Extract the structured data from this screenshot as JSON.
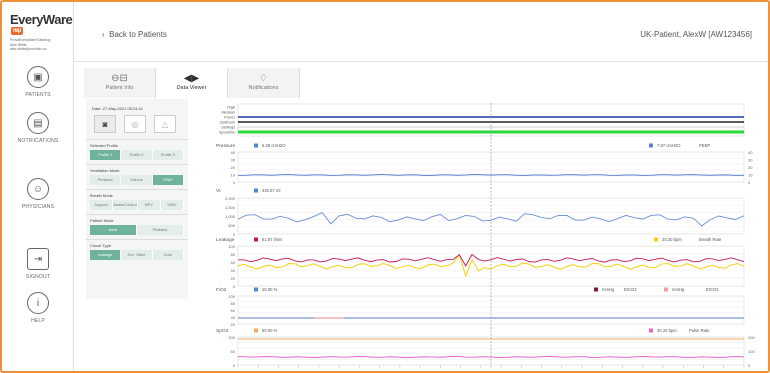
{
  "app": {
    "logo": "EveryWare",
    "logo_badge": "rep",
    "logo_sub": "by Breas"
  },
  "user": {
    "lines": [
      "ProvaEveryWareTrainAng",
      "Alex White",
      "alex.white@ourclinic.co"
    ]
  },
  "nav": [
    {
      "id": "patients",
      "label": "PATIENTS",
      "icon": "patients-icon"
    },
    {
      "id": "notifications",
      "label": "NOTIFICATIONS",
      "icon": "bell-icon"
    },
    {
      "id": "physicians",
      "label": "PHYSICIANS",
      "icon": "physician-icon"
    },
    {
      "id": "signout",
      "label": "SIGNOUT",
      "icon": "signout-icon"
    },
    {
      "id": "help",
      "label": "HELP",
      "icon": "help-icon"
    }
  ],
  "header": {
    "back": "Back to Patients",
    "patient": "UK-Patient, AlexW [AW123456]"
  },
  "tabs": [
    {
      "label": "Patient Info",
      "icon": "patient-info-icon"
    },
    {
      "label": "Data Viewer",
      "icon": "data-viewer-icon",
      "active": true
    },
    {
      "label": "Notifications",
      "icon": "bell-icon"
    }
  ],
  "panel": {
    "date": "Date: 27-May-2021 05:24:41",
    "groups": [
      {
        "label": "Selected Profile",
        "options": [
          "Profile 1",
          "Profile 2",
          "Profile 3"
        ],
        "selected": 0
      },
      {
        "label": "Ventilation Mode",
        "options": [
          "Pressure",
          "Volume",
          "CPAP"
        ],
        "selected": 2
      },
      {
        "label": "Breath Mode",
        "options": [
          "Support",
          "Assist/Control",
          "MPV",
          "SIMV"
        ],
        "selected": -1
      },
      {
        "label": "Patient Mode",
        "options": [
          "Adult",
          "Pediatric"
        ],
        "selected": 0
      },
      {
        "label": "Circuit Type",
        "options": [
          "Leakage",
          "Exh. Valve",
          "Dual"
        ],
        "selected": 0
      }
    ]
  },
  "charts": {
    "status_rows": [
      "High",
      "Medium",
      "Power",
      "Optimum",
      "Settings",
      "Spontime"
    ],
    "pressure": {
      "title": "Pressure",
      "legend_left": "6.28 cmH2O",
      "legend_right": "7.87 cmH2O",
      "legend_right_name": "PEEP",
      "yticks": [
        "40",
        "30",
        "20",
        "10",
        "0"
      ]
    },
    "vt": {
      "title": "Vt",
      "legend_left": "440.67 ml",
      "yticks": [
        "2,000",
        "1,500",
        "1,000",
        "500",
        "0"
      ]
    },
    "leakage": {
      "title": "Leakage",
      "legend_left": "61.87 l/min",
      "legend_right": "20.20 bpm",
      "legend_right_name": "Breath Rate",
      "yticks": [
        "100",
        "80",
        "60",
        "40",
        "20",
        "0"
      ]
    },
    "fio2": {
      "title": "FiO2",
      "legend_left": "20.00 %",
      "legend_mid": "mmHg",
      "legend_mid_name": "EtCO2",
      "legend_right": "mmHg",
      "legend_right_name": "EtCO2",
      "yticks": [
        "100",
        "80",
        "60",
        "40",
        "20"
      ]
    },
    "spo2": {
      "title": "SpO2",
      "legend_left": "90.00 %",
      "legend_right": "30.20 bpm",
      "legend_right_name": "Pulse Rate",
      "yticks": [
        "100",
        "50",
        "0"
      ]
    }
  },
  "colors": {
    "accent": "#f0913a",
    "green": "#6fb39b",
    "blue": "#5b7fd1",
    "magenta": "#c2185b",
    "yellow": "#f5d10f",
    "orange": "#f6a85c",
    "pink": "#e866c7",
    "darkred": "#8a1538"
  }
}
